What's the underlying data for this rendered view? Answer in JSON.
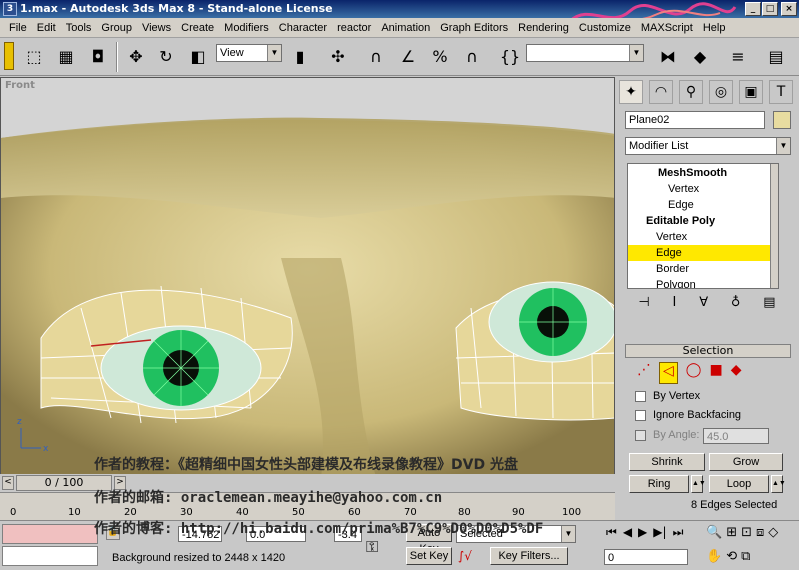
{
  "window": {
    "title": "1.max - Autodesk 3ds Max 8 - Stand-alone License",
    "min": "_",
    "max": "□",
    "close": "×"
  },
  "menu": [
    "File",
    "Edit",
    "Tools",
    "Group",
    "Views",
    "Create",
    "Modifiers",
    "Character",
    "reactor",
    "Animation",
    "Graph Editors",
    "Rendering",
    "Customize",
    "MAXScript",
    "Help"
  ],
  "toolbar": {
    "view_dropdown": "View",
    "selection_set": ""
  },
  "viewport": {
    "label": "Front"
  },
  "command_panel": {
    "object_name": "Plane02",
    "modifier_list": "Modifier List",
    "stack": [
      {
        "label": "MeshSmooth",
        "level": 0,
        "bold": true
      },
      {
        "label": "Vertex",
        "level": 1,
        "bold": false
      },
      {
        "label": "Edge",
        "level": 1,
        "bold": false
      },
      {
        "label": "Editable Poly",
        "level": 0,
        "bold": true
      },
      {
        "label": "Vertex",
        "level": 1,
        "bold": false
      },
      {
        "label": "Edge",
        "level": 1,
        "bold": false,
        "highlight": true
      },
      {
        "label": "Border",
        "level": 1,
        "bold": false
      },
      {
        "label": "Polygon",
        "level": 1,
        "bold": false
      }
    ],
    "selection_title": "Selection",
    "by_vertex": "By Vertex",
    "ignore_backfacing": "Ignore Backfacing",
    "by_angle": "By Angle:",
    "by_angle_value": "45.0",
    "shrink": "Shrink",
    "grow": "Grow",
    "ring": "Ring",
    "loop": "Loop",
    "selected_count": "8 Edges Selected"
  },
  "timeline": {
    "frame": "0 / 100",
    "ticks": [
      "0",
      "10",
      "20",
      "30",
      "40",
      "50",
      "60",
      "70",
      "80",
      "90",
      "100"
    ]
  },
  "status": {
    "message": "Background resized to 2448 x 1420",
    "x": "-14.752",
    "y": "0.0",
    "z": "-3.4",
    "auto_key": "Auto Key",
    "set_key": "Set Key",
    "selected": "Selected",
    "key_filters": "Key Filters...",
    "frame_value": "0"
  },
  "overlay": {
    "line1": "作者的教程：《超精细中国女性头部建模及布线录像教程》DVD 光盘",
    "line2": "作者的邮箱: oraclemean.meayihe@yahoo.com.cn",
    "line3": "作者的博客: http://hi.baidu.com/prima%B7%C9%D0%D0%D5%DF"
  },
  "colors": {
    "highlight": "#ffe800",
    "skin": "#d8c890",
    "iris": "#20c060"
  }
}
